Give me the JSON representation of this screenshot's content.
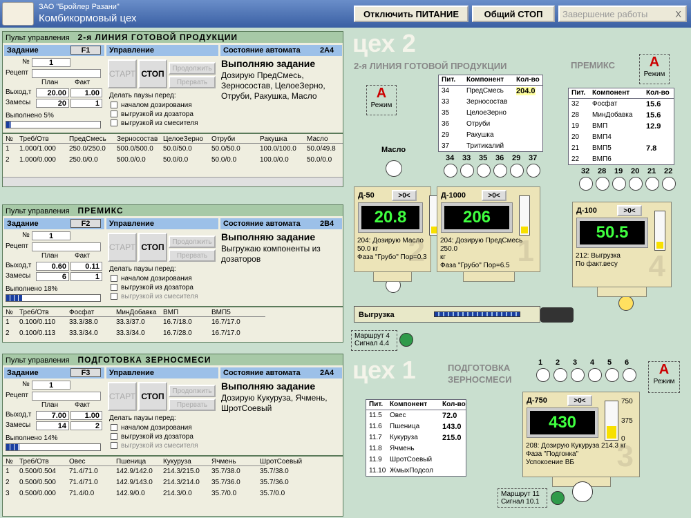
{
  "header": {
    "org": "ЗАО \"Бройлер Разани\"",
    "title": "Комбикормовый цех",
    "btn_power": "Отключить ПИТАНИЕ",
    "btn_stop": "Общий СТОП",
    "btn_end": "Завершение работы",
    "btn_close": "X"
  },
  "labels": {
    "pult": "Пульт управления",
    "task": "Задание",
    "control": "Управление",
    "state": "Состояние автомата",
    "num": "№",
    "recipe": "Рецепт",
    "plan": "План",
    "fact": "Факт",
    "output": "Выход,т",
    "batches": "Замесы",
    "pause": "Делать паузы перед:",
    "pause1": "началом дозирования",
    "pause2": "выгрузкой из дозатора",
    "pause3": "выгрузкой из смесителя",
    "start": "СТАРТ",
    "stop": "СТОП",
    "cont": "Продолжить",
    "abort": "Прервать",
    "mode": "Режим",
    "pit": "Пит.",
    "comp": "Компонент",
    "qty": "Кол-во",
    "unload": "Выгрузка",
    "reset": ">0<"
  },
  "p1": {
    "name": "2-я ЛИНИЯ ГОТОВОЙ ПРОДУКЦИИ",
    "code": "F1",
    "state_code": "2А4",
    "num": "1",
    "plan_out": "20.00",
    "fact_out": "1.00",
    "plan_b": "20",
    "fact_b": "1",
    "done": "Выполнено 5%",
    "status": "Выполняю задание",
    "desc": "Дозирую ПредСмесь, Зерносостав, ЦелоеЗерно, Отруби, Ракушка, Масло",
    "cols": [
      "№",
      "Треб/Отв",
      "ПредСмесь",
      "Зерносостав",
      "ЦелоеЗерно",
      "Отруби",
      "Ракушка",
      "Масло"
    ],
    "rows": [
      [
        "1",
        "1.000/1.000",
        "250.0/250.0",
        "500.0/500.0",
        "50.0/50.0",
        "50.0/50.0",
        "100.0/100.0",
        "50.0/49.8"
      ],
      [
        "2",
        "1.000/0.000",
        "250.0/0.0",
        "500.0/0.0",
        "50.0/0.0",
        "50.0/0.0",
        "100.0/0.0",
        "50.0/0.0"
      ]
    ]
  },
  "p2": {
    "name": "ПРЕМИКС",
    "code": "F2",
    "state_code": "2В4",
    "num": "1",
    "plan_out": "0.60",
    "fact_out": "0.11",
    "plan_b": "6",
    "fact_b": "1",
    "done": "Выполнено 18%",
    "status": "Выполняю задание",
    "desc": "Выгружаю компоненты из дозаторов",
    "cols": [
      "№",
      "Треб/Отв",
      "Фосфат",
      "МинДобавка",
      "ВМП",
      "ВМП5"
    ],
    "rows": [
      [
        "1",
        "0.100/0.110",
        "33.3/38.0",
        "33.3/37.0",
        "16.7/18.0",
        "16.7/17.0"
      ],
      [
        "2",
        "0.100/0.113",
        "33.3/34.0",
        "33.3/34.0",
        "16.7/28.0",
        "16.7/17.0"
      ]
    ]
  },
  "p3": {
    "name": "ПОДГОТОВКА ЗЕРНОСМЕСИ",
    "code": "F3",
    "state_code": "2А4",
    "num": "1",
    "plan_out": "7.00",
    "fact_out": "1.00",
    "plan_b": "14",
    "fact_b": "2",
    "done": "Выполнено 14%",
    "status": "Выполняю задание",
    "desc": "Дозирую Кукуруза, Ячмень, ШротСоевый",
    "cols": [
      "№",
      "Треб/Отв",
      "Овес",
      "Пшеница",
      "Кукуруза",
      "Ячмень",
      "ШротСоевый"
    ],
    "rows": [
      [
        "1",
        "0.500/0.504",
        "71.4/71.0",
        "142.9/142.0",
        "214.3/215.0",
        "35.7/38.0",
        "35.7/38.0"
      ],
      [
        "2",
        "0.500/0.500",
        "71.4/71.0",
        "142.9/143.0",
        "214.3/214.0",
        "35.7/36.0",
        "35.7/36.0"
      ],
      [
        "3",
        "0.500/0.000",
        "71.4/0.0",
        "142.9/0.0",
        "214.3/0.0",
        "35.7/0.0",
        "35.7/0.0"
      ]
    ]
  },
  "shop2": {
    "title": "цех 2",
    "line": "2-я ЛИНИЯ ГОТОВОЙ ПРОДУКЦИИ",
    "premix": "ПРЕМИКС",
    "oil": "Масло",
    "comps": [
      [
        "34",
        "ПредСмесь",
        "204.0"
      ],
      [
        "33",
        "Зерносостав",
        ""
      ],
      [
        "35",
        "ЦелоеЗерно",
        ""
      ],
      [
        "36",
        "Отруби",
        ""
      ],
      [
        "29",
        "Ракушка",
        ""
      ],
      [
        "37",
        "Тритикалий",
        ""
      ]
    ],
    "premix_comps": [
      [
        "32",
        "Фосфат",
        "15.6"
      ],
      [
        "28",
        "МинДобавка",
        "15.6"
      ],
      [
        "19",
        "ВМП",
        "12.9"
      ],
      [
        "20",
        "ВМП4",
        ""
      ],
      [
        "21",
        "ВМП5",
        "7.8"
      ],
      [
        "22",
        "ВМП6",
        ""
      ]
    ],
    "dial_nums": [
      "34",
      "33",
      "35",
      "36",
      "29",
      "37"
    ],
    "premix_nums": [
      "32",
      "28",
      "19",
      "20",
      "21",
      "22"
    ],
    "d50": {
      "name": "Д-50",
      "value": "20.8",
      "l1": "204: Дозирую Масло",
      "l2": "50.0 кг",
      "l3": "Фаза \"Грубо\" Пор=0.3",
      "bg": "2"
    },
    "d1000": {
      "name": "Д-1000",
      "value": "206",
      "l1": "204: Дозирую ПредСмесь 250.0",
      "l2": "кг",
      "l3": "Фаза \"Грубо\" Пор=6.5",
      "bg": "1"
    },
    "d100": {
      "name": "Д-100",
      "value": "50.5",
      "l1": "212: Выгрузка",
      "l2": "По факт.весу",
      "bg": "4"
    },
    "route": "Маршрут 4",
    "signal": "Сигнал 4.4"
  },
  "shop1": {
    "title": "цех 1",
    "line1": "ПОДГОТОВКА",
    "line2": "ЗЕРНОСМЕСИ",
    "comps": [
      [
        "11.5",
        "Овес",
        "72.0"
      ],
      [
        "11.6",
        "Пшеница",
        "143.0"
      ],
      [
        "11.7",
        "Кукуруза",
        "215.0"
      ],
      [
        "11.8",
        "Ячмень",
        ""
      ],
      [
        "11.9",
        "ШротСоевый",
        ""
      ],
      [
        "11.10",
        "ЖмыхПодсол",
        ""
      ]
    ],
    "dial_nums": [
      "1",
      "2",
      "3",
      "4",
      "5",
      "6"
    ],
    "d750": {
      "name": "Д-750",
      "value": "430",
      "l1": "208: Дозирую Кукуруза 214.3 кг",
      "l2": "Фаза \"Подгонка\"",
      "l3": "Успокоение ВБ",
      "bg": "3",
      "s1": "750",
      "s2": "375",
      "s3": "0"
    },
    "route": "Маршрут 11",
    "signal": "Сигнал 10.1"
  },
  "colors": {
    "accent": "#3a5fa3",
    "led": "#3fff3f",
    "progress": "#1a3fa0"
  }
}
